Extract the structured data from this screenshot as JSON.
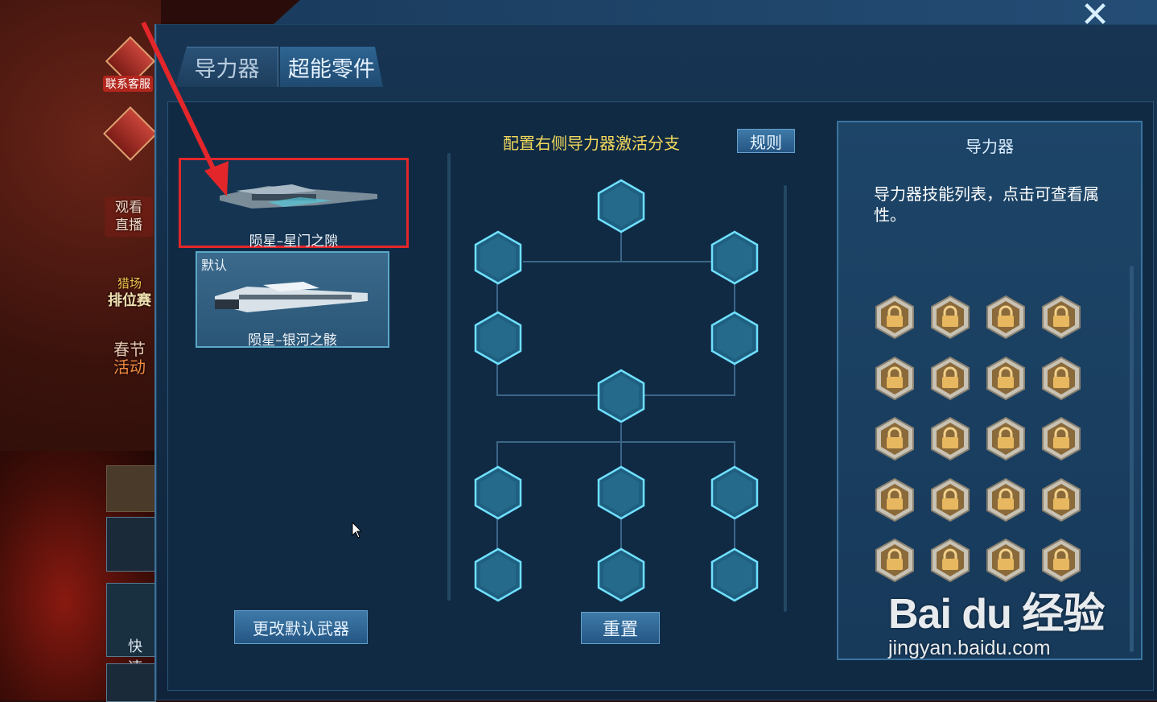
{
  "side": {
    "customer_service": "联系客服",
    "watch_live": "观看直播",
    "ranking": "排位赛",
    "ranking_top": "猎场",
    "spring_top": "春节",
    "spring_bottom": "活动",
    "quick": "快速"
  },
  "tabs": [
    {
      "label": "导力器",
      "active": false
    },
    {
      "label": "超能零件",
      "active": true
    }
  ],
  "weapons": [
    {
      "name": "陨星–星门之隙",
      "highlighted": true
    },
    {
      "name": "陨星–银河之骸",
      "default_tag": "默认"
    }
  ],
  "buttons": {
    "change_default": "更改默认武器",
    "reset": "重置",
    "rules": "规则",
    "close": "✕"
  },
  "tree": {
    "title": "配置右侧导力器激活分支",
    "node_count": 12
  },
  "skills": {
    "title": "导力器",
    "description": "导力器技能列表，点击可查看属性。",
    "rows": 5,
    "cols": 4
  },
  "watermark": {
    "logo": "Bai du 经验",
    "url": "jingyan.baidu.com"
  },
  "colors": {
    "panel": "#122a44",
    "accent": "#3a74a0",
    "title_yellow": "#f3d85c",
    "highlight_red": "#e3262a",
    "hex_fill": "#1f5f80",
    "hex_stroke": "#6fe0ff"
  }
}
